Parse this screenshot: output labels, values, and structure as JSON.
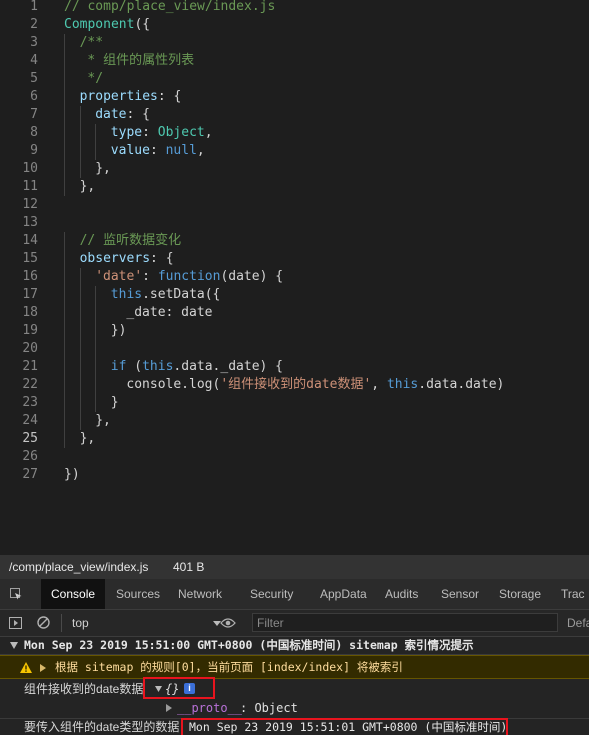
{
  "editor": {
    "lines": [
      {
        "n": "1",
        "indent": 0,
        "tokens": [
          {
            "t": "// comp/place_view/index.js",
            "c": "cm"
          }
        ]
      },
      {
        "n": "2",
        "indent": 0,
        "tokens": [
          {
            "t": "Component",
            "c": "fn"
          },
          {
            "t": "({",
            "c": "dflt"
          }
        ]
      },
      {
        "n": "3",
        "indent": 1,
        "tokens": [
          {
            "t": "/**",
            "c": "cm"
          }
        ]
      },
      {
        "n": "4",
        "indent": 1,
        "tokens": [
          {
            "t": " * 组件的属性列表",
            "c": "cm"
          }
        ]
      },
      {
        "n": "5",
        "indent": 1,
        "tokens": [
          {
            "t": " */",
            "c": "cm"
          }
        ]
      },
      {
        "n": "6",
        "indent": 1,
        "tokens": [
          {
            "t": "properties",
            "c": "pr"
          },
          {
            "t": ": {",
            "c": "dflt"
          }
        ]
      },
      {
        "n": "7",
        "indent": 2,
        "tokens": [
          {
            "t": "date",
            "c": "pr"
          },
          {
            "t": ": {",
            "c": "dflt"
          }
        ]
      },
      {
        "n": "8",
        "indent": 3,
        "tokens": [
          {
            "t": "type",
            "c": "pr"
          },
          {
            "t": ": ",
            "c": "dflt"
          },
          {
            "t": "Object",
            "c": "fn"
          },
          {
            "t": ",",
            "c": "dflt"
          }
        ]
      },
      {
        "n": "9",
        "indent": 3,
        "tokens": [
          {
            "t": "value",
            "c": "pr"
          },
          {
            "t": ": ",
            "c": "dflt"
          },
          {
            "t": "null",
            "c": "kw"
          },
          {
            "t": ",",
            "c": "dflt"
          }
        ]
      },
      {
        "n": "10",
        "indent": 2,
        "tokens": [
          {
            "t": "},",
            "c": "dflt"
          }
        ]
      },
      {
        "n": "11",
        "indent": 1,
        "tokens": [
          {
            "t": "},",
            "c": "dflt"
          }
        ]
      },
      {
        "n": "12",
        "indent": 0,
        "tokens": []
      },
      {
        "n": "13",
        "indent": 0,
        "tokens": []
      },
      {
        "n": "14",
        "indent": 1,
        "tokens": [
          {
            "t": "// 监听数据变化",
            "c": "cm"
          }
        ]
      },
      {
        "n": "15",
        "indent": 1,
        "tokens": [
          {
            "t": "observers",
            "c": "pr"
          },
          {
            "t": ": {",
            "c": "dflt"
          }
        ]
      },
      {
        "n": "16",
        "indent": 2,
        "tokens": [
          {
            "t": "'date'",
            "c": "st"
          },
          {
            "t": ": ",
            "c": "dflt"
          },
          {
            "t": "function",
            "c": "kw"
          },
          {
            "t": "(date) {",
            "c": "dflt"
          }
        ]
      },
      {
        "n": "17",
        "indent": 3,
        "tokens": [
          {
            "t": "this",
            "c": "kw"
          },
          {
            "t": ".setData({",
            "c": "dflt"
          }
        ]
      },
      {
        "n": "18",
        "indent": 4,
        "tokens": [
          {
            "t": "_date: date",
            "c": "dflt"
          }
        ]
      },
      {
        "n": "19",
        "indent": 3,
        "tokens": [
          {
            "t": "})",
            "c": "dflt"
          }
        ]
      },
      {
        "n": "20",
        "indent": 0,
        "tokens": []
      },
      {
        "n": "21",
        "indent": 3,
        "tokens": [
          {
            "t": "if",
            "c": "kw"
          },
          {
            "t": " (",
            "c": "dflt"
          },
          {
            "t": "this",
            "c": "kw"
          },
          {
            "t": ".data._date) {",
            "c": "dflt"
          }
        ]
      },
      {
        "n": "22",
        "indent": 4,
        "tokens": [
          {
            "t": "console.log(",
            "c": "dflt"
          },
          {
            "t": "'组件接收到的date数据'",
            "c": "st"
          },
          {
            "t": ", ",
            "c": "dflt"
          },
          {
            "t": "this",
            "c": "kw"
          },
          {
            "t": ".data.date)",
            "c": "dflt"
          }
        ]
      },
      {
        "n": "23",
        "indent": 3,
        "tokens": [
          {
            "t": "}",
            "c": "dflt"
          }
        ]
      },
      {
        "n": "24",
        "indent": 2,
        "tokens": [
          {
            "t": "},",
            "c": "dflt"
          }
        ]
      },
      {
        "n": "25",
        "indent": 1,
        "tokens": [
          {
            "t": "},",
            "c": "dflt"
          }
        ]
      },
      {
        "n": "26",
        "indent": 0,
        "tokens": []
      },
      {
        "n": "27",
        "indent": 0,
        "tokens": [
          {
            "t": "})",
            "c": "dflt"
          }
        ]
      }
    ],
    "active_line": "25",
    "colors": {
      "cm": "#6a9955",
      "kw": "#569cd6",
      "fn": "#4ec9b0",
      "pr": "#9cdcfe",
      "st": "#ce9178",
      "dflt": "#d4d4d4"
    }
  },
  "status": {
    "path": "/comp/place_view/index.js",
    "size": "401 B"
  },
  "devtools": {
    "tabs": [
      "Console",
      "Sources",
      "Network",
      "Security",
      "AppData",
      "Audits",
      "Sensor",
      "Storage",
      "Trac"
    ],
    "active_tab": "Console",
    "context": "top",
    "filter_placeholder": "Filter",
    "levels": "Defa"
  },
  "console": {
    "group": "Mon Sep 23 2019 15:51:00 GMT+0800 (中国标准时间) sitemap 索引情况提示",
    "warning": "根据 sitemap 的规则[0]，当前页面 [index/index] 将被索引",
    "log1_label": "组件接收到的date数据",
    "log1_value": "{}",
    "info_badge": "i",
    "proto_key": "__proto__",
    "proto_value": ": Object",
    "log2_label": "要传入组件的date类型的数据",
    "log2_value": "Mon Sep 23 2019 15:51:01 GMT+0800 (中国标准时间)"
  }
}
